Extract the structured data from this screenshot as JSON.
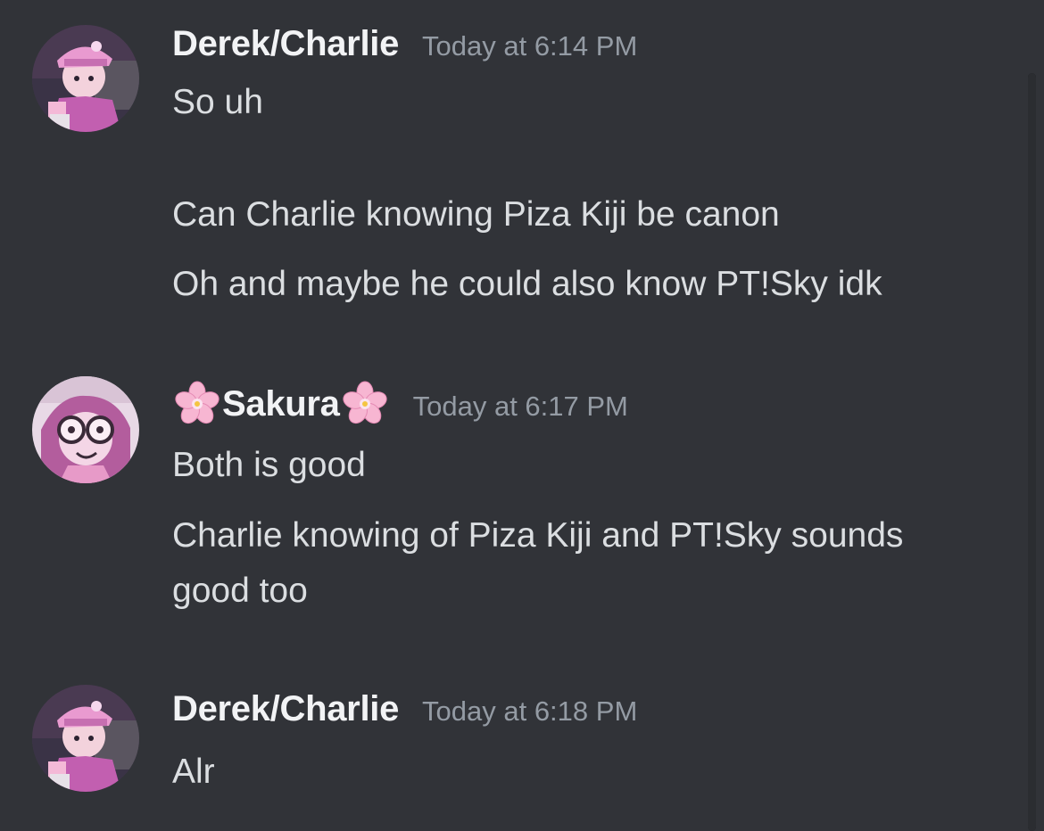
{
  "messages": [
    {
      "author": "Derek/Charlie",
      "timestamp": "Today at 6:14 PM",
      "avatar_icon": "pink-hat-character-avatar",
      "lines": [
        "So uh",
        "Can Charlie knowing Piza Kiji be canon",
        "Oh and maybe he could also know PT!Sky idk"
      ]
    },
    {
      "author": "Sakura",
      "author_decoration": "cherry-blossom-emoji",
      "timestamp": "Today at 6:17 PM",
      "avatar_icon": "glasses-character-avatar",
      "lines": [
        "Both is good",
        "Charlie knowing of Piza Kiji and PT!Sky sounds",
        "good too"
      ]
    },
    {
      "author": "Derek/Charlie",
      "timestamp": "Today at 6:18 PM",
      "avatar_icon": "pink-hat-character-avatar",
      "lines": [
        "Alr"
      ]
    }
  ],
  "colors": {
    "background": "#313338",
    "username": "#f2f3f5",
    "message_text": "#dbdee1",
    "timestamp": "#949ba4"
  }
}
